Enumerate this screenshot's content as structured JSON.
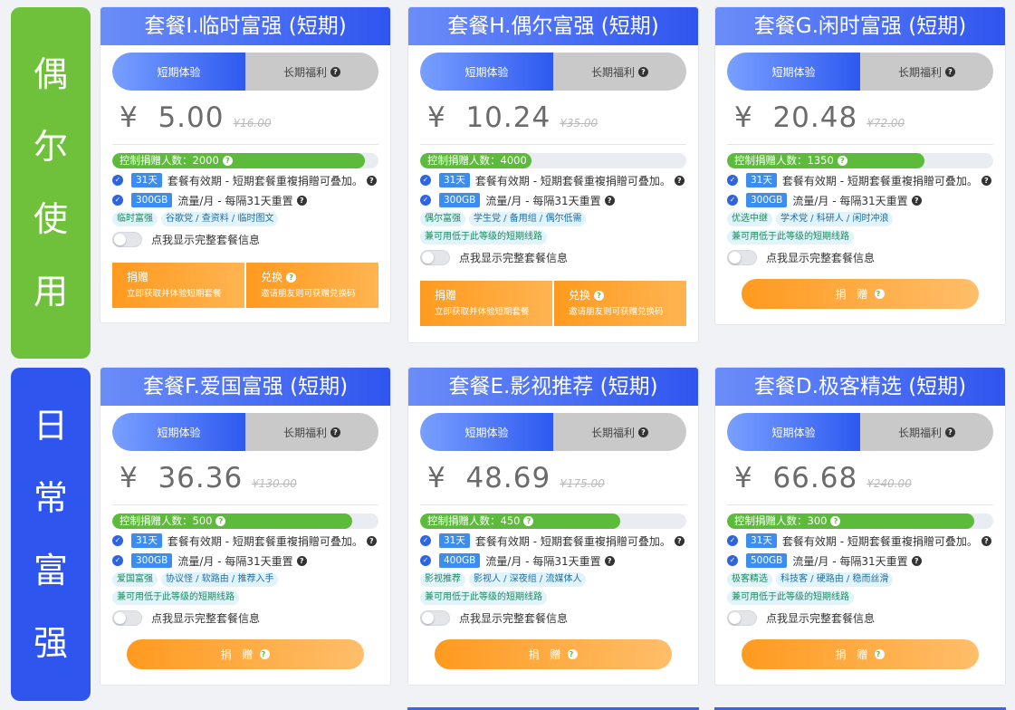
{
  "colors": {
    "section1": "#6fc03a",
    "section2": "#2f55ef",
    "accent": "#ff9a1f",
    "progress": "#5dbb3c"
  },
  "common": {
    "tab_short": "短期体验",
    "tab_long": "长期福利",
    "feature_validity": "套餐有效期 - 短期套餐重複捐贈可叠加。",
    "feature_traffic": "流量/月 - 每隔31天重置",
    "switch_label": "点我显示完整套餐信息",
    "donate_label": "捐 赠",
    "donate_title": "捐赠",
    "donate_sub": "立即获取并体验短期套餐",
    "redeem_title": "兑换",
    "redeem_sub": "邀请朋友则可获赠兑换码",
    "currency": "¥"
  },
  "sections": [
    {
      "label": [
        "偶",
        "尔",
        "使",
        "用"
      ]
    },
    {
      "label": [
        "日",
        "常",
        "富",
        "强"
      ]
    }
  ],
  "plans": [
    {
      "title": "套餐I.临时富强 (短期)",
      "price": "5.00",
      "orig": "¥16.00",
      "donors": "控制捐赠人数：2000",
      "fill": 0.95,
      "days": "31天",
      "traffic": "300GB",
      "tags": [
        "临时富强",
        "谷歌党 / 查资料 / 临时图文"
      ],
      "lower": null
    },
    {
      "title": "套餐H.偶尔富强 (短期)",
      "price": "10.24",
      "orig": "¥35.00",
      "donors": "控制捐赠人数：4000",
      "fill": 0.42,
      "days": "31天",
      "traffic": "300GB",
      "tags": [
        "偶尔富强",
        "学生党 / 备用组 / 偶尔低需"
      ],
      "lower": "兼可用低于此等级的短期线路"
    },
    {
      "title": "套餐G.闲时富强 (短期)",
      "price": "20.48",
      "orig": "¥72.00",
      "donors": "控制捐赠人数：1350",
      "fill": 0.74,
      "days": "31天",
      "traffic": "300GB",
      "tags": [
        "优选中继",
        "学术党 / 科研人 / 闲时冲浪"
      ],
      "lower": "兼可用低于此等级的短期线路"
    },
    {
      "title": "套餐F.爱国富强 (短期)",
      "price": "36.36",
      "orig": "¥130.00",
      "donors": "控制捐赠人数：500",
      "fill": 0.9,
      "days": "31天",
      "traffic": "300GB",
      "tags": [
        "爱国富强",
        "协议怪 / 软路由 / 推荐入手"
      ],
      "lower": "兼可用低于此等级的短期线路"
    },
    {
      "title": "套餐E.影视推荐 (短期)",
      "price": "48.69",
      "orig": "¥175.00",
      "donors": "控制捐赠人数：450",
      "fill": 0.75,
      "days": "31天",
      "traffic": "400GB",
      "tags": [
        "影视推荐",
        "影视人 / 深夜组 / 流媒体人"
      ],
      "lower": "兼可用低于此等级的短期线路"
    },
    {
      "title": "套餐D.极客精选 (短期)",
      "price": "66.68",
      "orig": "¥240.00",
      "donors": "控制捐赠人数：300",
      "fill": 0.93,
      "days": "31天",
      "traffic": "500GB",
      "tags": [
        "极客精选",
        "科技客 / 硬路由 / 稳而丝滑"
      ],
      "lower": "兼可用低于此等级的短期线路"
    }
  ]
}
